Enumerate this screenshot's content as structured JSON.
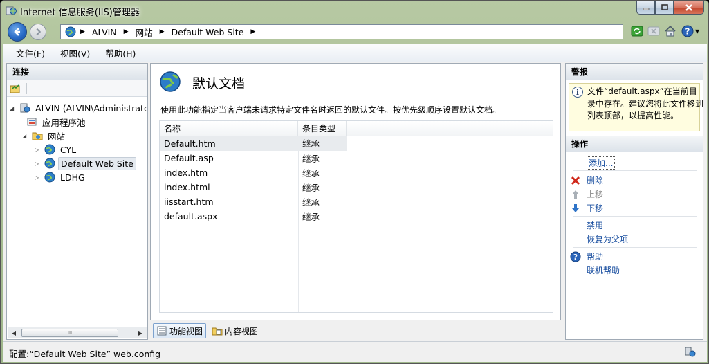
{
  "window": {
    "title": "Internet 信息服务(IIS)管理器"
  },
  "address": {
    "crumbs": [
      "ALVIN",
      "网站",
      "Default Web Site"
    ]
  },
  "menu": {
    "file": "文件(F)",
    "view": "视图(V)",
    "help": "帮助(H)"
  },
  "connections": {
    "header": "连接",
    "tree": [
      {
        "label": "ALVIN (ALVIN\\Administrato",
        "icon": "server-icon"
      },
      {
        "label": "应用程序池",
        "icon": "app-pool-icon"
      },
      {
        "label": "网站",
        "icon": "sites-folder-icon"
      },
      {
        "label": "CYL",
        "icon": "globe-icon"
      },
      {
        "label": "Default Web Site",
        "icon": "globe-icon"
      },
      {
        "label": "LDHG",
        "icon": "globe-icon"
      }
    ],
    "scroll_thumb": "III"
  },
  "feature": {
    "title": "默认文档",
    "description": "使用此功能指定当客户端未请求特定文件名时返回的默认文件。按优先级顺序设置默认文档。",
    "columns": [
      "名称",
      "条目类型"
    ],
    "rows": [
      {
        "name": "Default.htm",
        "type": "继承"
      },
      {
        "name": "Default.asp",
        "type": "继承"
      },
      {
        "name": "index.htm",
        "type": "继承"
      },
      {
        "name": "index.html",
        "type": "继承"
      },
      {
        "name": "iisstart.htm",
        "type": "继承"
      },
      {
        "name": "default.aspx",
        "type": "继承"
      }
    ]
  },
  "view_tabs": {
    "features": "功能视图",
    "content": "内容视图"
  },
  "alerts": {
    "header": "警报",
    "message": "文件“default.aspx”在当前目录中存在。建议您将此文件移到列表顶部，以提高性能。"
  },
  "actions": {
    "header": "操作",
    "add": "添加...",
    "remove": "删除",
    "move_up": "上移",
    "move_down": "下移",
    "disable": "禁用",
    "revert": "恢复为父项",
    "help": "帮助",
    "online_help": "联机帮助"
  },
  "status": {
    "text": "配置:“Default Web Site” web.config"
  },
  "colors": {
    "link": "#1a4fa0",
    "alert_bg": "#fffde0",
    "close_button": "#c2452b"
  }
}
